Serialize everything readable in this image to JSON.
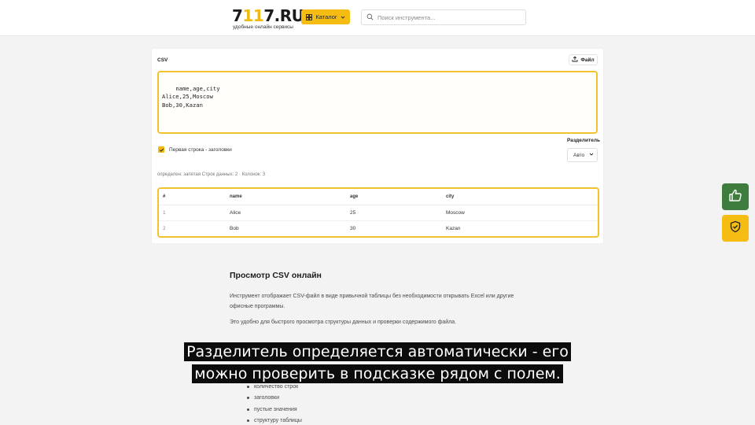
{
  "header": {
    "logo_prefix": "7",
    "logo_accent": "11",
    "logo_suffix": "7.RU",
    "logo_tagline": "удобные онлайн сервисы",
    "catalog_label": "Каталог",
    "search_placeholder": "Поиск инструмента..."
  },
  "editor": {
    "title": "CSV",
    "file_button": "Файл",
    "csv_text": "name,age,city\nAlice,25,Moscow\nBob,30,Kazan",
    "header_checkbox_label": "Первая строка - заголовки",
    "header_checkbox_checked": true,
    "separator_label": "Разделитель",
    "separator_value": "Авто",
    "detect_info": "определен: запятая Строк данных: 2 · Колонок: 3"
  },
  "table": {
    "headers": [
      "#",
      "name",
      "age",
      "city"
    ],
    "rows": [
      [
        "1",
        "Alice",
        "25",
        "Moscow"
      ],
      [
        "2",
        "Bob",
        "30",
        "Kazan"
      ]
    ]
  },
  "article": {
    "heading": "Просмотр CSV онлайн",
    "p1": "Инструмент отображает CSV-файл в виде привычной таблицы без необходимости открывать Excel или другие офисные программы.",
    "p2": "Это удобно для быстрого просмотра структуры данных и проверки содержимого файла.",
    "bullets": [
      "количество строк",
      "заголовки",
      "пустые значения",
      "структуру таблицы"
    ]
  },
  "subtitles": {
    "line1": "Разделитель определяется автоматически - его",
    "line2": "можно проверить в подсказке рядом с полем."
  },
  "icons": {
    "like": "thumbs-up-icon",
    "shield": "shield-check-icon"
  },
  "colors": {
    "accent": "#f5bd13",
    "like_bg": "#3f7d3e"
  }
}
